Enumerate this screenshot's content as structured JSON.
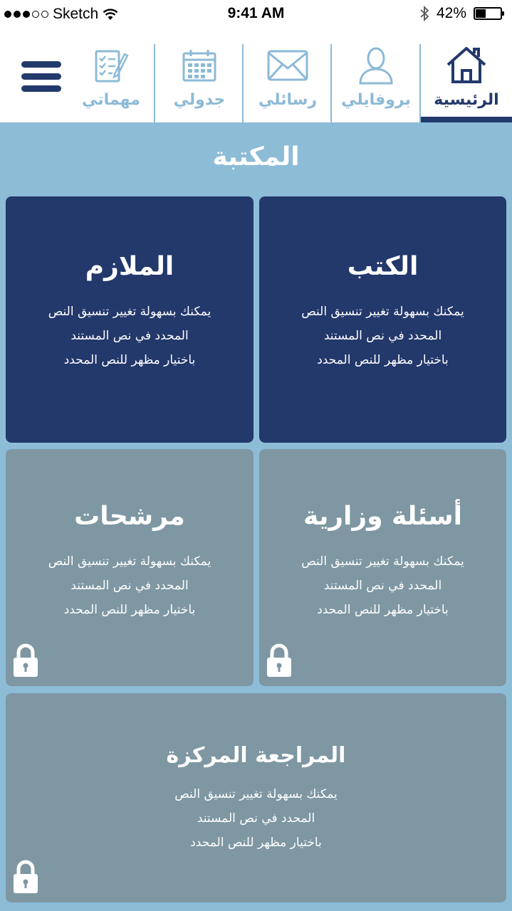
{
  "status_bar": {
    "carrier": "Sketch",
    "time": "9:41 AM",
    "battery": "42%",
    "battery_level": 0.42
  },
  "nav": {
    "items": [
      {
        "label": "الرئيسية",
        "icon": "home-icon",
        "active": true
      },
      {
        "label": "بروفايلي",
        "icon": "profile-icon",
        "active": false
      },
      {
        "label": "رسائلي",
        "icon": "mail-icon",
        "active": false
      },
      {
        "label": "جدولي",
        "icon": "calendar-icon",
        "active": false
      },
      {
        "label": "مهماتي",
        "icon": "tasks-icon",
        "active": false
      }
    ],
    "menu_icon": "hamburger-menu-icon"
  },
  "colors": {
    "brand_dark": "#22396b",
    "brand_light": "#8cbad6",
    "background": "#8dbcd7",
    "locked_card": "#7e97a3"
  },
  "page": {
    "title": "المكتبة"
  },
  "cards": [
    {
      "title": "الكتب",
      "lines": [
        "يمكنك بسهولة تغيير تنسيق النص",
        "المحدد في نص المستند",
        "باختيار مظهر للنص المحدد"
      ],
      "locked": false
    },
    {
      "title": "الملازم",
      "lines": [
        "يمكنك بسهولة تغيير تنسيق النص",
        "المحدد في نص المستند",
        "باختيار مظهر للنص المحدد"
      ],
      "locked": false
    },
    {
      "title": "أسئلة وزارية",
      "lines": [
        "يمكنك بسهولة تغيير تنسيق النص",
        "المحدد في نص المستند",
        "باختيار مظهر للنص المحدد"
      ],
      "locked": true
    },
    {
      "title": "مرشحات",
      "lines": [
        "يمكنك بسهولة تغيير تنسيق النص",
        "المحدد في نص المستند",
        "باختيار مظهر للنص المحدد"
      ],
      "locked": true
    },
    {
      "title": "المراجعة المركزة",
      "lines": [
        "يمكنك بسهولة تغيير تنسيق النص",
        "المحدد في نص المستند",
        "باختيار مظهر للنص المحدد"
      ],
      "locked": true
    }
  ]
}
